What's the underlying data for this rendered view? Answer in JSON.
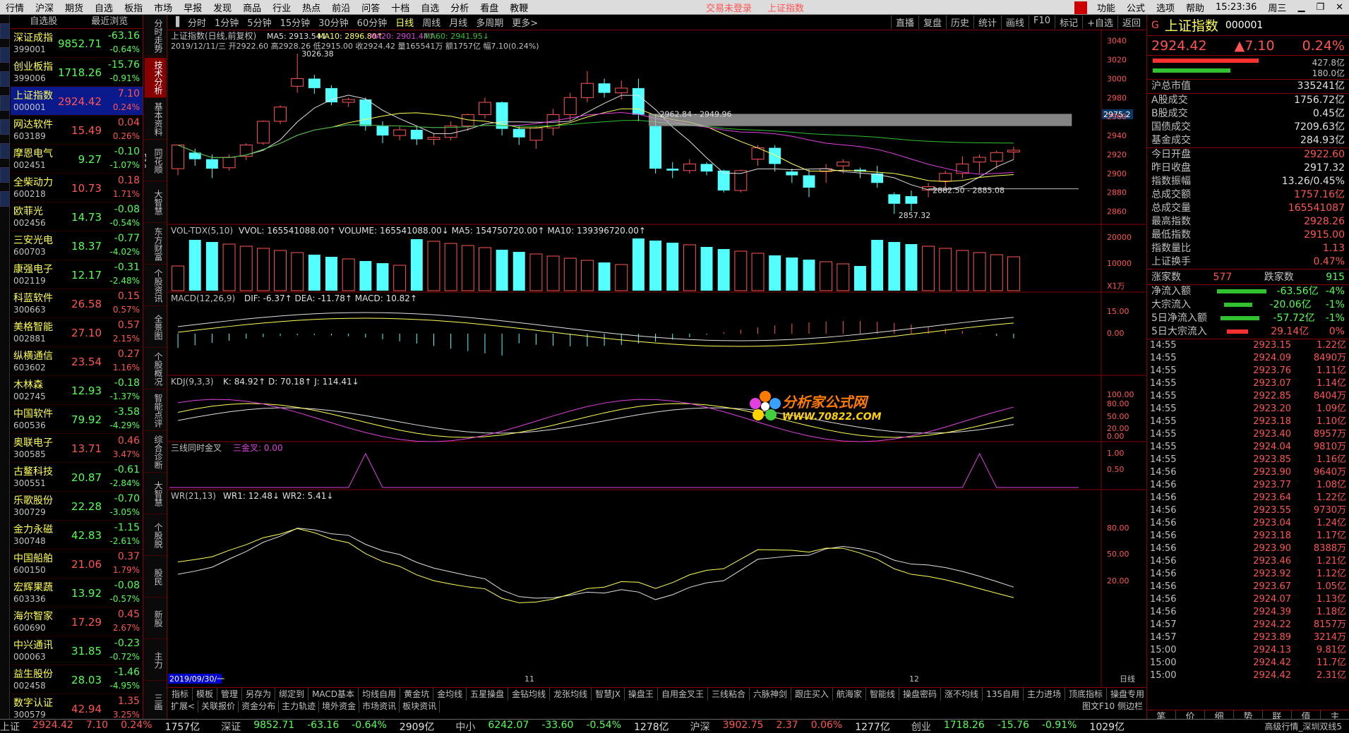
{
  "menubar": {
    "items": [
      "行情",
      "沪深",
      "期货",
      "自选",
      "板指",
      "市场",
      "早报",
      "发现",
      "商品",
      "行业",
      "热点",
      "前沿",
      "问答",
      "十档",
      "自选",
      "分析",
      "看盘",
      "教鞭"
    ],
    "status": [
      "交易未登录",
      "上证指数"
    ],
    "right": [
      "功能",
      "公式",
      "选项",
      "帮助",
      "15:23:36",
      "周三"
    ]
  },
  "watchlist": {
    "header": [
      "自选股",
      "最近浏览"
    ],
    "rows": [
      {
        "name": "深证成指",
        "code": "399001",
        "price": "9852.71",
        "chg": "-63.16",
        "pct": "-0.64%",
        "up": false
      },
      {
        "name": "创业板指",
        "code": "399006",
        "price": "1718.26",
        "chg": "-15.76",
        "pct": "-0.91%",
        "up": false
      },
      {
        "name": "上证指数",
        "code": "000001",
        "price": "2924.42",
        "chg": "7.10",
        "pct": "0.24%",
        "up": true,
        "sel": true
      },
      {
        "name": "网达软件",
        "code": "603189",
        "price": "15.49",
        "chg": "0.04",
        "pct": "0.26%",
        "up": true
      },
      {
        "name": "摩恩电气",
        "code": "002451",
        "price": "9.27",
        "chg": "-0.10",
        "pct": "-1.07%",
        "up": false
      },
      {
        "name": "全柴动力",
        "code": "600218",
        "price": "10.73",
        "chg": "0.18",
        "pct": "1.71%",
        "up": true
      },
      {
        "name": "欧菲光",
        "code": "002456",
        "price": "14.73",
        "chg": "-0.08",
        "pct": "-0.54%",
        "up": false
      },
      {
        "name": "三安光电",
        "code": "600703",
        "price": "18.37",
        "chg": "-0.77",
        "pct": "-4.02%",
        "up": false
      },
      {
        "name": "康强电子",
        "code": "002119",
        "price": "12.17",
        "chg": "-0.31",
        "pct": "-2.48%",
        "up": false
      },
      {
        "name": "科蓝软件",
        "code": "300663",
        "price": "26.58",
        "chg": "0.15",
        "pct": "0.57%",
        "up": true
      },
      {
        "name": "美格智能",
        "code": "002881",
        "price": "27.10",
        "chg": "0.57",
        "pct": "2.15%",
        "up": true
      },
      {
        "name": "纵横通信",
        "code": "603602",
        "price": "23.54",
        "chg": "0.27",
        "pct": "1.16%",
        "up": true
      },
      {
        "name": "木林森",
        "code": "002745",
        "price": "12.93",
        "chg": "-0.18",
        "pct": "-1.37%",
        "up": false
      },
      {
        "name": "中国软件",
        "code": "600536",
        "price": "79.92",
        "chg": "-3.58",
        "pct": "-4.29%",
        "up": false
      },
      {
        "name": "奥联电子",
        "code": "300585",
        "price": "13.71",
        "chg": "0.46",
        "pct": "3.47%",
        "up": true
      },
      {
        "name": "古鳌科技",
        "code": "300551",
        "price": "20.87",
        "chg": "-0.61",
        "pct": "-2.84%",
        "up": false
      },
      {
        "name": "乐歌股份",
        "code": "300729",
        "price": "22.28",
        "chg": "-0.70",
        "pct": "-3.05%",
        "up": false
      },
      {
        "name": "金力永磁",
        "code": "300748",
        "price": "42.83",
        "chg": "-1.15",
        "pct": "-2.61%",
        "up": false
      },
      {
        "name": "中国船舶",
        "code": "600150",
        "price": "21.06",
        "chg": "0.37",
        "pct": "1.79%",
        "up": true
      },
      {
        "name": "宏辉果蔬",
        "code": "603336",
        "price": "13.92",
        "chg": "-0.08",
        "pct": "-0.57%",
        "up": false
      },
      {
        "name": "海尔智家",
        "code": "600690",
        "price": "17.29",
        "chg": "0.45",
        "pct": "2.67%",
        "up": true
      },
      {
        "name": "中兴通讯",
        "code": "000063",
        "price": "31.85",
        "chg": "-0.23",
        "pct": "-0.72%",
        "up": false
      },
      {
        "name": "益生股份",
        "code": "002458",
        "price": "28.03",
        "chg": "-1.46",
        "pct": "-4.95%",
        "up": false
      },
      {
        "name": "数字认证",
        "code": "300579",
        "price": "42.94",
        "chg": "1.35",
        "pct": "3.25%",
        "up": true
      }
    ]
  },
  "vtabs": [
    "分时走势",
    "技术分析",
    "基本资料",
    "同花顺F10",
    "大智慧",
    "东方财富",
    "个股资讯",
    "全景图",
    "个股概况",
    "智能点评",
    "综合诊断",
    "大智慧",
    "个股脱",
    "股民",
    "新股",
    "主力",
    "三画"
  ],
  "periodbar": {
    "items": [
      "分时",
      "1分钟",
      "5分钟",
      "15分钟",
      "30分钟",
      "60分钟",
      "日线",
      "周线",
      "月线",
      "多周期",
      "更多>"
    ],
    "active": "日线",
    "right": [
      "直播",
      "复盘",
      "历史",
      "统计",
      "画线",
      "F10",
      "标记",
      "+自选",
      "返回"
    ]
  },
  "chart_info": {
    "title": "上证指数(日线,前复权)",
    "ma_line": [
      "MA5: 2913.54↓",
      "MA10: 2896.80↑",
      "MA20: 2901.44↑",
      "MA60: 2941.95↓"
    ],
    "info2": "2019/12/11/三 开2922.60 高2928.26 低2915.00 收2924.42 量165541万 额1757亿 幅7.10(0.24%)",
    "annotations": [
      "3026.38",
      "2962.84 - 2949.96",
      "2882.50 - 2885.08",
      "2857.32"
    ],
    "price_tag": "2975.2",
    "y_ticks": [
      "3040",
      "3020",
      "3000",
      "2980",
      "2960",
      "2940",
      "2920",
      "2900",
      "2880",
      "2860"
    ],
    "vol_title": "VOL-TDX(5,10)",
    "vol_vals": "VVOL: 165541088.00↑  VOLUME: 165541088.00↓  MA5: 154750720.00↑  MA10: 139396720.00↑",
    "vol_ticks": [
      "20000",
      "10000",
      "X1万"
    ],
    "macd_title": "MACD(12,26,9)",
    "macd_vals": "DIF: -6.37↑  DEA: -11.78↑  MACD: 10.82↑",
    "macd_ticks": [
      "15.00",
      "0.00"
    ],
    "kdj_title": "KDJ(9,3,3)",
    "kdj_vals": "K: 84.92↑  D: 70.18↑  J: 114.41↓",
    "kdj_ticks": [
      "100.00",
      "80.00",
      "50.00",
      "20.00",
      "0.00"
    ],
    "sx_title": "三线同时金叉",
    "sx_vals": "三金叉: 0.00",
    "sx_ticks": [
      "1.00",
      "0.50"
    ],
    "wr_title": "WR(21,13)",
    "wr_vals": "WR1: 12.48↓  WR2: 5.41↓",
    "wr_ticks": [
      "80.00",
      "50.00",
      "20.00"
    ],
    "x_labels": [
      "2019/09/30/一",
      "11",
      "12"
    ],
    "x_right": "日线"
  },
  "watermark": {
    "cn": "分析家公式网",
    "url": "WWW.70822.COM"
  },
  "bottomtabs": {
    "row1": [
      "指标",
      "模板",
      "管理",
      "另存为",
      "绑定到",
      "MACD基本",
      "均线自用",
      "黄金坑",
      "金均线",
      "五星操盘",
      "金钻均线",
      "龙张均线",
      "智慧JX",
      "操盘王",
      "自用金叉王",
      "三线粘合",
      "六脉神剑",
      "跟庄买入",
      "航海家",
      "智能线",
      "操盘密码",
      "涨不均线",
      "135自用",
      "主力进场",
      "顶底指标",
      "操盘专用"
    ],
    "row2": [
      "扩展<",
      "关联报价",
      "资金分布",
      "主力轨迹",
      "境外资金",
      "市场资讯",
      "板块资讯"
    ],
    "row2right": "图文F10 侧边栏"
  },
  "rightpanel": {
    "title": "上证指数",
    "code": "000001",
    "price": "2924.42",
    "chg": "▲7.10",
    "pct": "0.24%",
    "bar_nums": [
      "427.8亿",
      "180.0亿"
    ],
    "sec1": [
      [
        "沪总市值",
        "335241亿"
      ]
    ],
    "sec2": [
      [
        "A股成交",
        "1756.72亿"
      ],
      [
        "B股成交",
        "0.45亿"
      ],
      [
        "国债成交",
        "7209.63亿"
      ],
      [
        "基金成交",
        "284.93亿"
      ]
    ],
    "sec3": [
      [
        "今日开盘",
        "2922.60"
      ],
      [
        "昨日收盘",
        "2917.32"
      ],
      [
        "指数振幅",
        "13.26/0.45%"
      ],
      [
        "总成交额",
        "1757.16亿"
      ],
      [
        "总成交量",
        "165541087"
      ],
      [
        "最高指数",
        "2928.26"
      ],
      [
        "最低指数",
        "2915.00"
      ],
      [
        "指数量比",
        "1.13"
      ],
      [
        "上证换手",
        "0.47%"
      ]
    ],
    "updown": {
      "up_label": "涨家数",
      "up": "577",
      "down_label": "跌家数",
      "down": "915"
    },
    "flows": [
      [
        "净流入额",
        "-63.56亿",
        "-4%"
      ],
      [
        "大宗流入",
        "-20.06亿",
        "-1%"
      ],
      [
        "5日净流入额",
        "-57.72亿",
        "-1%"
      ],
      [
        "5日大宗流入",
        "29.14亿",
        "0%"
      ]
    ],
    "ticks": [
      [
        "14:55",
        "2923.15",
        "1.22亿"
      ],
      [
        "14:55",
        "2924.09",
        "8490万"
      ],
      [
        "14:55",
        "2923.76",
        "1.11亿"
      ],
      [
        "14:55",
        "2923.07",
        "1.14亿"
      ],
      [
        "14:55",
        "2922.85",
        "8404万"
      ],
      [
        "14:55",
        "2923.20",
        "1.09亿"
      ],
      [
        "14:55",
        "2923.18",
        "1.10亿"
      ],
      [
        "14:55",
        "2923.40",
        "8957万"
      ],
      [
        "14:55",
        "2924.04",
        "9810万"
      ],
      [
        "14:55",
        "2923.85",
        "1.16亿"
      ],
      [
        "14:56",
        "2923.90",
        "9640万"
      ],
      [
        "14:56",
        "2923.77",
        "1.08亿"
      ],
      [
        "14:56",
        "2923.64",
        "1.22亿"
      ],
      [
        "14:56",
        "2923.55",
        "9730万"
      ],
      [
        "14:56",
        "2923.04",
        "1.24亿"
      ],
      [
        "14:56",
        "2923.18",
        "1.17亿"
      ],
      [
        "14:56",
        "2923.90",
        "8388万"
      ],
      [
        "14:56",
        "2923.46",
        "1.21亿"
      ],
      [
        "14:56",
        "2923.92",
        "1.12亿"
      ],
      [
        "14:56",
        "2923.67",
        "1.05亿"
      ],
      [
        "14:56",
        "2924.07",
        "1.13亿"
      ],
      [
        "14:56",
        "2924.39",
        "1.18亿"
      ],
      [
        "14:57",
        "2924.22",
        "8157万"
      ],
      [
        "14:57",
        "2923.89",
        "3214万"
      ],
      [
        "15:00",
        "2924.13",
        "9.81亿"
      ],
      [
        "15:00",
        "2924.42",
        "11.7亿"
      ],
      [
        "15:00",
        "2924.42",
        "2.31亿"
      ]
    ],
    "bottom": [
      "笔",
      "价",
      "细",
      "势",
      "联",
      "值",
      "主"
    ]
  },
  "statusbar": [
    {
      "name": "上证",
      "price": "2924.42",
      "chg": "7.10",
      "pct": "0.24%",
      "amt": "1757亿",
      "up": true
    },
    {
      "name": "深证",
      "price": "9852.71",
      "chg": "-63.16",
      "pct": "-0.64%",
      "amt": "2909亿",
      "up": false
    },
    {
      "name": "中小",
      "price": "6242.07",
      "chg": "-33.60",
      "pct": "-0.54%",
      "amt": "1278亿",
      "up": false
    },
    {
      "name": "沪深",
      "price": "3902.75",
      "chg": "2.37",
      "pct": "0.06%",
      "amt": "1277亿",
      "up": true
    },
    {
      "name": "创业",
      "price": "1718.26",
      "chg": "-15.76",
      "pct": "-0.91%",
      "amt": "1029亿",
      "up": false
    }
  ],
  "status_right": "高级行情_深圳双线5",
  "chart_data": {
    "type": "candlestick",
    "series_candles": [
      [
        2905,
        2930,
        2898,
        2922
      ],
      [
        2922,
        2915,
        2908,
        2926
      ],
      [
        2915,
        2905,
        2895,
        2920
      ],
      [
        2906,
        2917,
        2903,
        2920
      ],
      [
        2918,
        2930,
        2914,
        2932
      ],
      [
        2932,
        2955,
        2930,
        2956
      ],
      [
        2955,
        2970,
        2952,
        2972
      ],
      [
        2992,
        3000,
        2985,
        3026.38
      ],
      [
        3000,
        2990,
        2984,
        3004
      ],
      [
        2990,
        2975,
        2972,
        2993
      ],
      [
        2975,
        2978,
        2970,
        2980
      ],
      [
        2978,
        2950,
        2945,
        2980
      ],
      [
        2950,
        2940,
        2932,
        2955
      ],
      [
        2940,
        2946,
        2935,
        2950
      ],
      [
        2946,
        2936,
        2930,
        2950
      ],
      [
        2936,
        2938,
        2930,
        2942
      ],
      [
        2938,
        2950,
        2935,
        2955
      ],
      [
        2950,
        2962,
        2945,
        2963
      ],
      [
        2962,
        2975,
        2958,
        2980
      ],
      [
        2975,
        2947,
        2940,
        2976
      ],
      [
        2947,
        2938,
        2930,
        2950
      ],
      [
        2935,
        2948,
        2926,
        2950
      ],
      [
        2948,
        2962,
        2940,
        2968
      ],
      [
        2962,
        2980,
        2955,
        2985
      ],
      [
        2980,
        2995,
        2975,
        3008
      ],
      [
        2995,
        2985,
        2980,
        3000
      ],
      [
        2985,
        2990,
        2978,
        2998
      ],
      [
        2990,
        2962,
        2955,
        3000
      ],
      [
        2950,
        2905,
        2900,
        2962.84
      ],
      [
        2905,
        2903,
        2895,
        2912
      ],
      [
        2903,
        2910,
        2900,
        2915
      ],
      [
        2910,
        2902,
        2898,
        2912
      ],
      [
        2903,
        2882,
        2880,
        2904
      ],
      [
        2882,
        2903,
        2880,
        2904
      ],
      [
        2915,
        2927,
        2908,
        2930
      ],
      [
        2927,
        2910,
        2902,
        2930
      ],
      [
        2902,
        2898,
        2890,
        2905
      ],
      [
        2898,
        2885,
        2875,
        2904
      ],
      [
        2902,
        2905,
        2890,
        2910
      ],
      [
        2908,
        2912,
        2900,
        2915
      ],
      [
        2904,
        2902,
        2895,
        2906
      ],
      [
        2900,
        2890,
        2885,
        2908
      ],
      [
        2878,
        2868,
        2857.32,
        2880
      ],
      [
        2876,
        2868,
        2860,
        2882
      ],
      [
        2882.5,
        2886,
        2875,
        2890
      ],
      [
        2892,
        2900,
        2885,
        2903
      ],
      [
        2900,
        2910,
        2895,
        2918
      ],
      [
        2912,
        2917,
        2900,
        2920
      ],
      [
        2913,
        2922,
        2905,
        2924
      ],
      [
        2922.6,
        2924.42,
        2915,
        2928.26
      ]
    ],
    "ylim": [
      2850,
      3045
    ]
  }
}
